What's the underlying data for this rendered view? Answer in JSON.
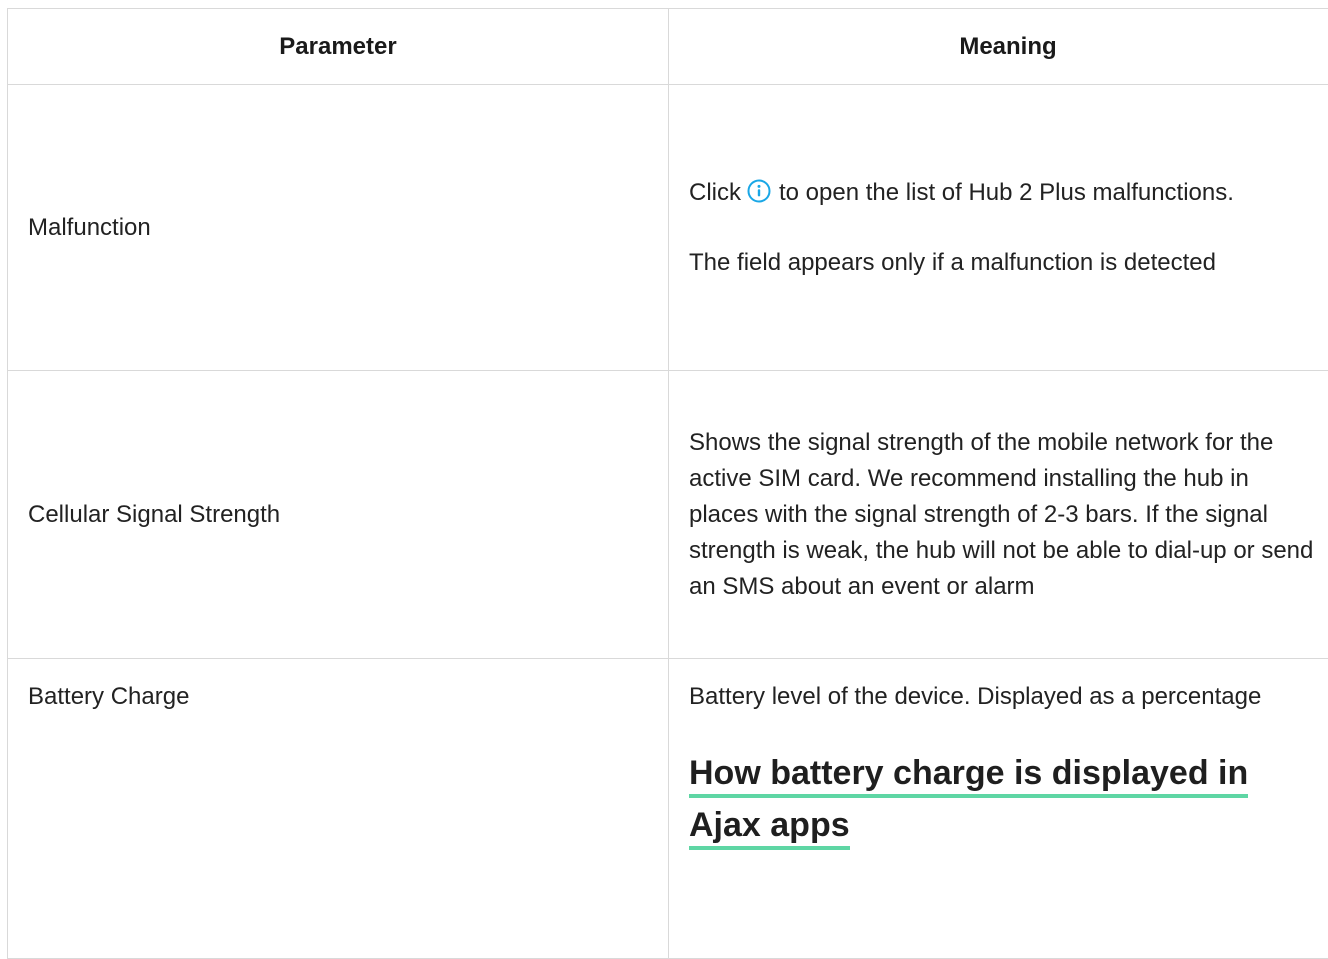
{
  "table": {
    "headers": {
      "parameter": "Parameter",
      "meaning": "Meaning"
    },
    "rows": [
      {
        "parameter": "Malfunction",
        "meaning_before_icon": "Click",
        "meaning_after_icon": "to open the list of Hub 2 Plus malfunctions.",
        "meaning_note": "The field appears only if a malfunction is detected",
        "icon": "info-icon"
      },
      {
        "parameter": "Cellular Signal Strength",
        "meaning": "Shows the signal strength of the mobile network for the active SIM card. We recommend installing the hub in places with the signal strength of 2-3 bars. If the signal strength is weak, the hub will not be able to dial-up or send an SMS about an event or alarm"
      },
      {
        "parameter": "Battery Charge",
        "meaning": "Battery level of the device. Displayed as a percentage",
        "link_text": "How battery charge is displayed in Ajax apps"
      }
    ]
  },
  "colors": {
    "border": "#d9d9d9",
    "link_underline": "#5ed6a4",
    "info_icon": "#1aa7e6"
  }
}
